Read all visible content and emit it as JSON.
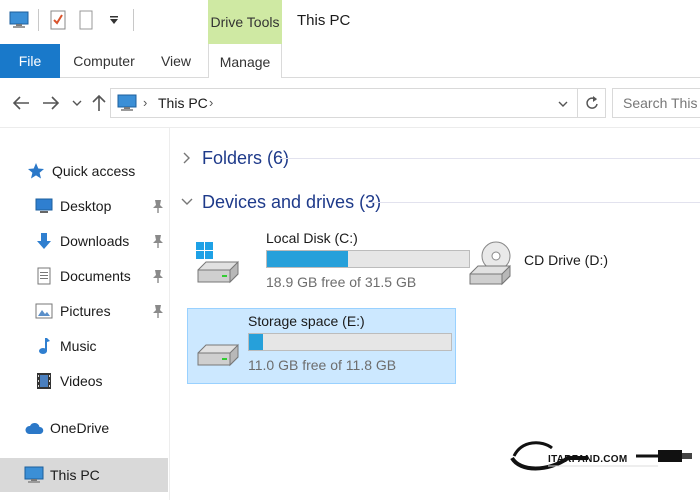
{
  "window": {
    "title": "This PC",
    "contextual_tab_group": "Drive Tools"
  },
  "ribbon": {
    "tabs": [
      {
        "label": "File"
      },
      {
        "label": "Computer"
      },
      {
        "label": "View"
      },
      {
        "label": "Manage"
      }
    ]
  },
  "address_bar": {
    "crumbs": [
      "This PC"
    ],
    "search_placeholder": "Search This PC"
  },
  "sidebar": {
    "quick_access": {
      "label": "Quick access",
      "icon": "star-icon"
    },
    "items": [
      {
        "label": "Desktop",
        "icon": "desktop-icon",
        "pinned": true
      },
      {
        "label": "Downloads",
        "icon": "download-icon",
        "pinned": true
      },
      {
        "label": "Documents",
        "icon": "documents-icon",
        "pinned": true
      },
      {
        "label": "Pictures",
        "icon": "pictures-icon",
        "pinned": true
      },
      {
        "label": "Music",
        "icon": "music-icon",
        "pinned": false
      },
      {
        "label": "Videos",
        "icon": "videos-icon",
        "pinned": false
      }
    ],
    "onedrive": {
      "label": "OneDrive",
      "icon": "cloud-icon"
    },
    "this_pc": {
      "label": "This PC",
      "icon": "computer-icon",
      "selected": true
    }
  },
  "main": {
    "groups": [
      {
        "label": "Folders (6)",
        "expanded": false
      },
      {
        "label": "Devices and drives (3)",
        "expanded": true
      }
    ],
    "drives": [
      {
        "name": "Local Disk (C:)",
        "free_text": "18.9 GB free of 31.5 GB",
        "used_fraction": 0.4,
        "icon": "windows-drive-icon",
        "selected": false
      },
      {
        "name": "CD Drive (D:)",
        "free_text": "",
        "icon": "cd-drive-icon",
        "selected": false
      },
      {
        "name": "Storage space (E:)",
        "free_text": "11.0 GB free of 11.8 GB",
        "used_fraction": 0.068,
        "icon": "hard-drive-icon",
        "selected": true
      }
    ]
  },
  "watermark": {
    "text": "ITARFAND.COM"
  },
  "colors": {
    "accent": "#1979ca",
    "drive_tools_tab": "#cfe9a3",
    "progress_fill": "#26a0da",
    "selection_bg": "#cce8ff",
    "group_header_text": "#1e3a8a"
  }
}
